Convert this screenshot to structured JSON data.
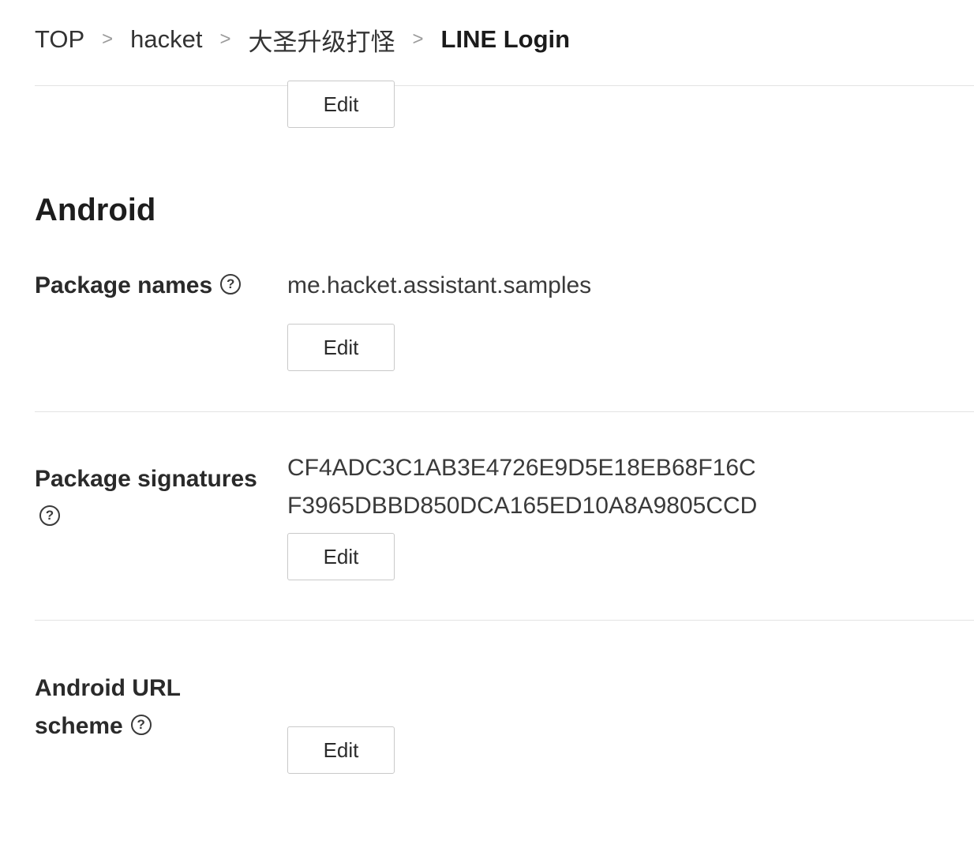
{
  "breadcrumb": {
    "items": [
      "TOP",
      "hacket",
      "大圣升级打怪",
      "LINE Login"
    ],
    "separator": ">"
  },
  "top_section": {
    "edit_label": "Edit"
  },
  "android": {
    "title": "Android",
    "help_glyph": "?",
    "package_names": {
      "label": "Package names",
      "value": "me.hacket.assistant.samples",
      "edit_label": "Edit"
    },
    "package_signatures": {
      "label": "Package signatures",
      "values": [
        "CF4ADC3C1AB3E4726E9D5E18EB68F16C",
        "F3965DBBD850DCA165ED10A8A9805CCD"
      ],
      "edit_label": "Edit"
    },
    "url_scheme": {
      "label_line1": "Android URL",
      "label_line2": "scheme",
      "edit_label": "Edit"
    }
  },
  "colors": {
    "text": "#2c2c2c",
    "divider": "#e3e3e3",
    "button_border": "#c9c9c9"
  }
}
